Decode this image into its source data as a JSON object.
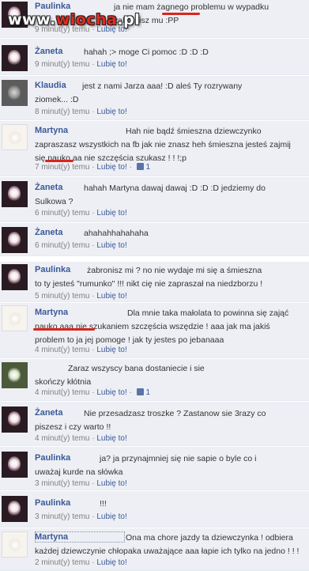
{
  "watermark": {
    "part1": "www.",
    "part2": "wiocha",
    "part3": ".pl"
  },
  "meta": {
    "like": "Lubię to!",
    "sep": "·"
  },
  "comments": [
    {
      "name": "Paulinka",
      "text": "ja nie mam żagnego problemu w wypadku\nżabronisz mu :PP",
      "time": "9 minut(y) temu",
      "likes": ""
    },
    {
      "name": "Żaneta",
      "text": "hahah ;> moge Ci pomoc :D :D :D",
      "time": "9 minut(y) temu",
      "likes": ""
    },
    {
      "name": "Klaudia",
      "text": "jest z nami Jarza aaa! :D aleś Ty rozrywany\nziomek... :D",
      "time": "8 minut(y) temu",
      "likes": ""
    },
    {
      "name": "Martyna",
      "text": "Hah nie bądź śmieszna dziewczynko\nzapraszasz wszystkich na fb jak nie znasz heh śmieszna jesteś zajmij\nsię nauko aa nie szczęścia szukasz ! ! !;p",
      "time": "7 minut(y) temu",
      "likes": "1"
    },
    {
      "name": "Żaneta",
      "text": "hahah Martyna dawaj dawaj :D :D :D jedziemy do\nSulkowa ?",
      "time": "6 minut(y) temu",
      "likes": ""
    },
    {
      "name": "Żaneta",
      "text": "ahahahhahahaha",
      "time": "6 minut(y) temu",
      "likes": ""
    },
    {
      "name": "Paulinka",
      "text": "żabronisz mi ? no nie wydaje mi się a śmieszna\nto ty jesteś \"rumunko\" !!! nikt cię nie zapraszał na niedzborzu !",
      "time": "5 minut(y) temu",
      "likes": ""
    },
    {
      "name": "Martyna",
      "text": "Dla mnie taka małolata to powinna się zająć\nnauko aaa nie szukaniem szczęścia wszędzie ! aaa jak ma jakiś\nproblem to ja jej pomoge ! jak ty jestes po jebanaaa",
      "time": "4 minut(y) temu",
      "likes": ""
    },
    {
      "name": "",
      "text": "Zaraz wszyscy bana dostaniecie i sie\nskończy kłótnia",
      "time": "4 minut(y) temu",
      "likes": "1"
    },
    {
      "name": "Żaneta",
      "text": "Nie przesadzasz troszke ? Zastanow sie 3razy co\npiszesz i czy warto !!",
      "time": "4 minut(y) temu",
      "likes": ""
    },
    {
      "name": "Paulinka",
      "text": "ja? ja przynajmniej się nie sapie o byle co i\nuważaj kurde na słówka",
      "time": "3 minut(y) temu",
      "likes": ""
    },
    {
      "name": "Paulinka",
      "text": "!!!",
      "time": "3 minut(y) temu",
      "likes": ""
    },
    {
      "name": "Martyna",
      "text": "Ona ma chore jazdy ta dziewczynka ! odbiera\nkażdej dziewczynie chłopaka uważające aaa łapie ich tylko na jedno ! ! !",
      "time": "2 minut(y) temu",
      "likes": ""
    }
  ]
}
